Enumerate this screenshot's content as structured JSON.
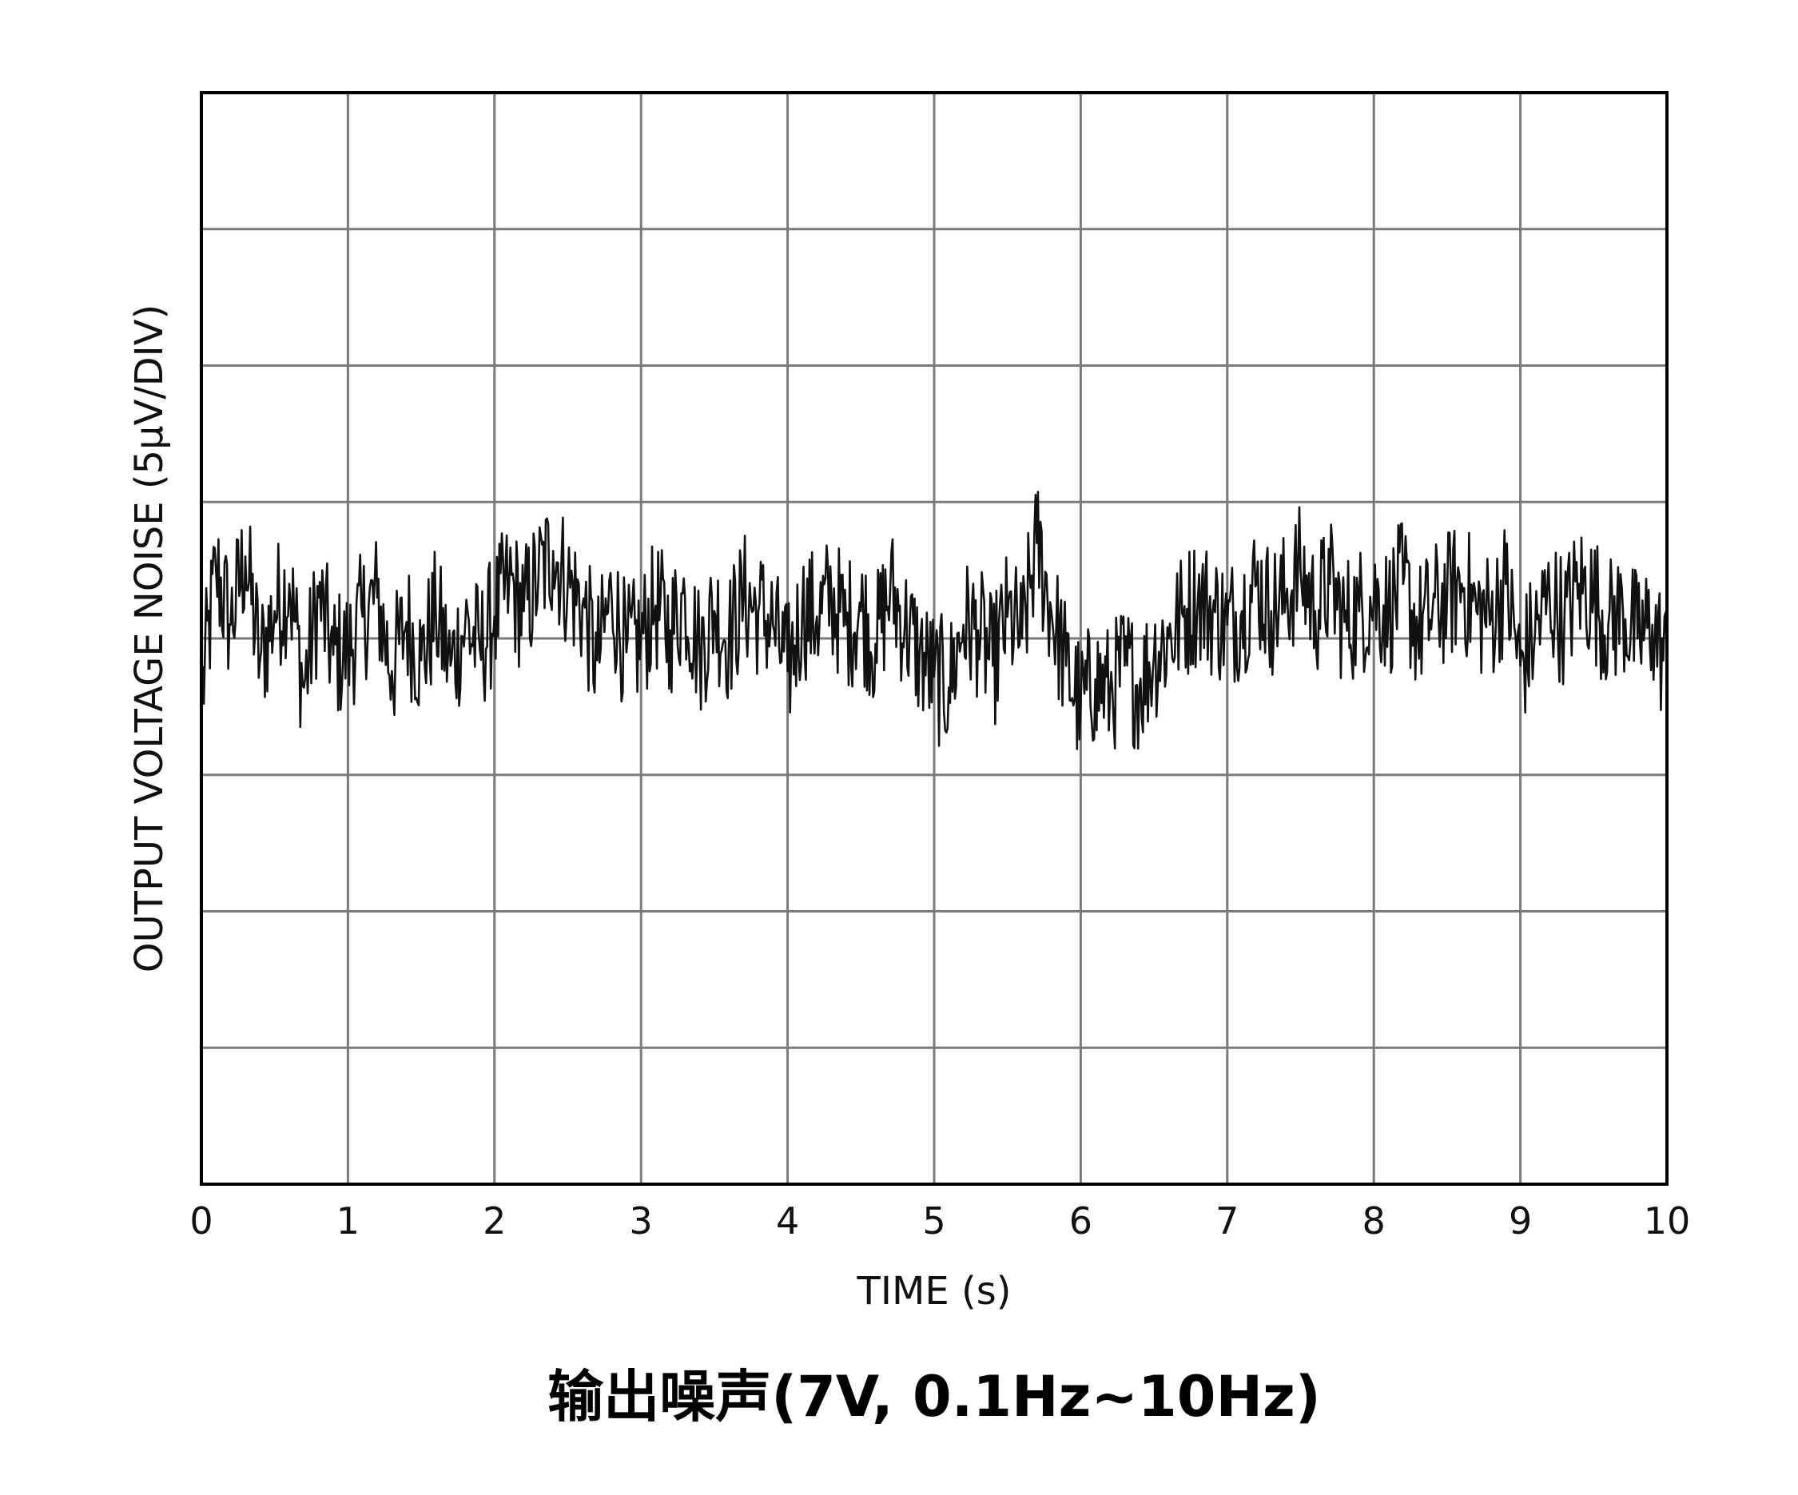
{
  "chart_data": {
    "type": "line",
    "caption": "输出噪声(7V, 0.1Hz~10Hz)",
    "xlabel": "TIME (s)",
    "ylabel": "OUTPUT VOLTAGE NOISE (5µV/DIV)",
    "xlim": [
      0,
      10
    ],
    "ylim": [
      -20,
      20
    ],
    "x_ticks": [
      "0",
      "1",
      "2",
      "3",
      "4",
      "5",
      "6",
      "7",
      "8",
      "9",
      "10"
    ],
    "y_divisions": 8,
    "grid": true,
    "colors": {
      "trace": "#111111",
      "grid": "#7a7a7a",
      "frame": "#000000"
    },
    "series": [
      {
        "x": [
          0.0,
          0.1,
          0.2,
          0.3,
          0.4,
          0.5,
          0.6,
          0.7,
          0.8,
          0.9,
          1.0,
          1.1,
          1.2,
          1.3,
          1.4,
          1.5,
          1.6,
          1.7,
          1.8,
          1.9,
          2.0,
          2.1,
          2.2,
          2.3,
          2.4,
          2.5,
          2.6,
          2.7,
          2.8,
          2.9,
          3.0,
          3.1,
          3.2,
          3.3,
          3.4,
          3.5,
          3.6,
          3.7,
          3.8,
          3.9,
          4.0,
          4.1,
          4.2,
          4.3,
          4.4,
          4.5,
          4.6,
          4.7,
          4.8,
          4.9,
          5.0,
          5.1,
          5.2,
          5.3,
          5.4,
          5.5,
          5.6,
          5.7,
          5.8,
          5.9,
          6.0,
          6.1,
          6.2,
          6.3,
          6.4,
          6.5,
          6.6,
          6.7,
          6.8,
          6.9,
          7.0,
          7.1,
          7.2,
          7.3,
          7.4,
          7.5,
          7.6,
          7.7,
          7.8,
          7.9,
          8.0,
          8.1,
          8.2,
          8.3,
          8.4,
          8.5,
          8.6,
          8.7,
          8.8,
          8.9,
          9.0,
          9.1,
          9.2,
          9.3,
          9.4,
          9.5,
          9.6,
          9.7,
          9.8,
          9.9,
          10.0
        ],
        "y": [
          -2.2,
          2.5,
          0.5,
          3.0,
          -0.8,
          1.0,
          2.0,
          -1.8,
          1.5,
          -0.6,
          -0.5,
          0.8,
          1.5,
          -1.2,
          0.6,
          -0.8,
          0.9,
          -1.0,
          0.5,
          -0.4,
          0.8,
          2.0,
          1.0,
          2.2,
          3.2,
          2.0,
          1.2,
          -0.8,
          1.5,
          -0.5,
          0.0,
          1.2,
          0.3,
          1.5,
          -0.5,
          1.0,
          0.0,
          1.5,
          1.0,
          0.5,
          -1.2,
          1.0,
          0.8,
          1.5,
          0.5,
          1.0,
          -0.2,
          1.8,
          0.5,
          -0.6,
          -1.4,
          -1.8,
          0.5,
          0.3,
          -1.0,
          0.8,
          0.0,
          3.5,
          1.0,
          -1.0,
          -2.5,
          -1.5,
          -2.0,
          -1.0,
          -1.8,
          -0.6,
          0.0,
          0.8,
          1.5,
          1.0,
          0.5,
          1.0,
          2.0,
          1.0,
          1.5,
          2.5,
          1.0,
          2.0,
          0.6,
          1.0,
          1.5,
          1.0,
          2.0,
          0.3,
          1.0,
          1.5,
          2.0,
          1.0,
          0.8,
          2.0,
          -1.0,
          0.2,
          1.5,
          0.6,
          2.0,
          1.5,
          0.5,
          1.0,
          0.0,
          0.5,
          -1.0
        ]
      }
    ]
  }
}
